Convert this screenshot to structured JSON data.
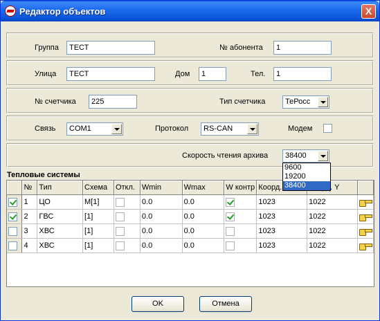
{
  "window": {
    "title": "Редактор объектов",
    "close_glyph": "X"
  },
  "row1": {
    "group_label": "Группа",
    "group_value": "ТЕСТ",
    "subscriber_label": "№ абонента",
    "subscriber_value": "1"
  },
  "row2": {
    "street_label": "Улица",
    "street_value": "ТЕСТ",
    "house_label": "Дом",
    "house_value": "1",
    "phone_label": "Тел.",
    "phone_value": "1"
  },
  "row3": {
    "meter_no_label": "№ счетчика",
    "meter_no_value": "225",
    "meter_type_label": "Тип счетчика",
    "meter_type_value": "ТеРосс"
  },
  "row4": {
    "link_label": "Связь",
    "link_value": "COM1",
    "protocol_label": "Протокол",
    "protocol_value": "RS-CAN",
    "modem_label": "Модем",
    "modem_checked": false
  },
  "row5": {
    "speed_label": "Скорость чтения архива",
    "speed_value": "38400",
    "speed_options": [
      "9600",
      "19200",
      "38400"
    ]
  },
  "heat_systems": {
    "title": "Тепловые системы",
    "columns": [
      "",
      "№",
      "Тип",
      "Схема",
      "Откл.",
      "Wmin",
      "Wmax",
      "W контр",
      "Коорд. X",
      "Коорд. Y",
      ""
    ],
    "rows": [
      {
        "checked": true,
        "no": "1",
        "type": "ЦО",
        "scheme": "M[1]",
        "off": false,
        "wmin": "0.0",
        "wmax": "0.0",
        "wctl": true,
        "x": "1023",
        "y": "1022"
      },
      {
        "checked": true,
        "no": "2",
        "type": "ГВС",
        "scheme": "[1]",
        "off": false,
        "wmin": "0.0",
        "wmax": "0.0",
        "wctl": true,
        "x": "1023",
        "y": "1022"
      },
      {
        "checked": false,
        "no": "3",
        "type": "ХВС",
        "scheme": "[1]",
        "off": false,
        "wmin": "0.0",
        "wmax": "0.0",
        "wctl": false,
        "x": "1023",
        "y": "1022"
      },
      {
        "checked": false,
        "no": "4",
        "type": "ХВС",
        "scheme": "[1]",
        "off": false,
        "wmin": "0.0",
        "wmax": "0.0",
        "wctl": false,
        "x": "1023",
        "y": "1022"
      }
    ]
  },
  "buttons": {
    "ok": "OK",
    "cancel": "Отмена"
  }
}
